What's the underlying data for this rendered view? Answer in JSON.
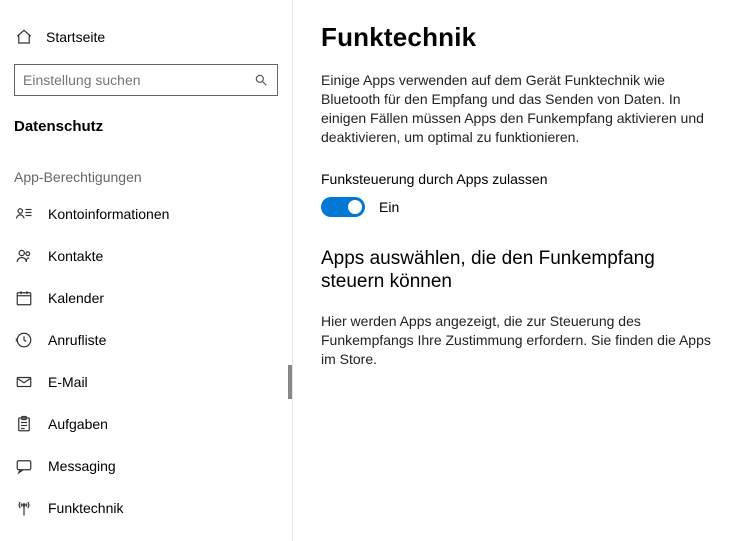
{
  "sidebar": {
    "home_label": "Startseite",
    "search_placeholder": "Einstellung suchen",
    "section_heading": "Datenschutz",
    "subsection_heading": "App-Berechtigungen",
    "items": [
      {
        "label": "Kontoinformationen"
      },
      {
        "label": "Kontakte"
      },
      {
        "label": "Kalender"
      },
      {
        "label": "Anrufliste"
      },
      {
        "label": "E-Mail"
      },
      {
        "label": "Aufgaben"
      },
      {
        "label": "Messaging"
      },
      {
        "label": "Funktechnik"
      }
    ]
  },
  "content": {
    "title": "Funktechnik",
    "description": "Einige Apps verwenden auf dem Gerät Funktechnik wie Bluetooth für den Empfang und das Senden von Daten. In einigen Fällen müssen Apps den Funkempfang aktivieren und deaktivieren, um optimal zu funktionieren.",
    "toggle_label": "Funksteuerung durch Apps zulassen",
    "toggle_state": "Ein",
    "sub_title": "Apps auswählen, die den Funkempfang steuern können",
    "sub_description": "Hier werden Apps angezeigt, die zur Steuerung des Funkempfangs Ihre Zustimmung erfordern. Sie finden die Apps im Store."
  }
}
